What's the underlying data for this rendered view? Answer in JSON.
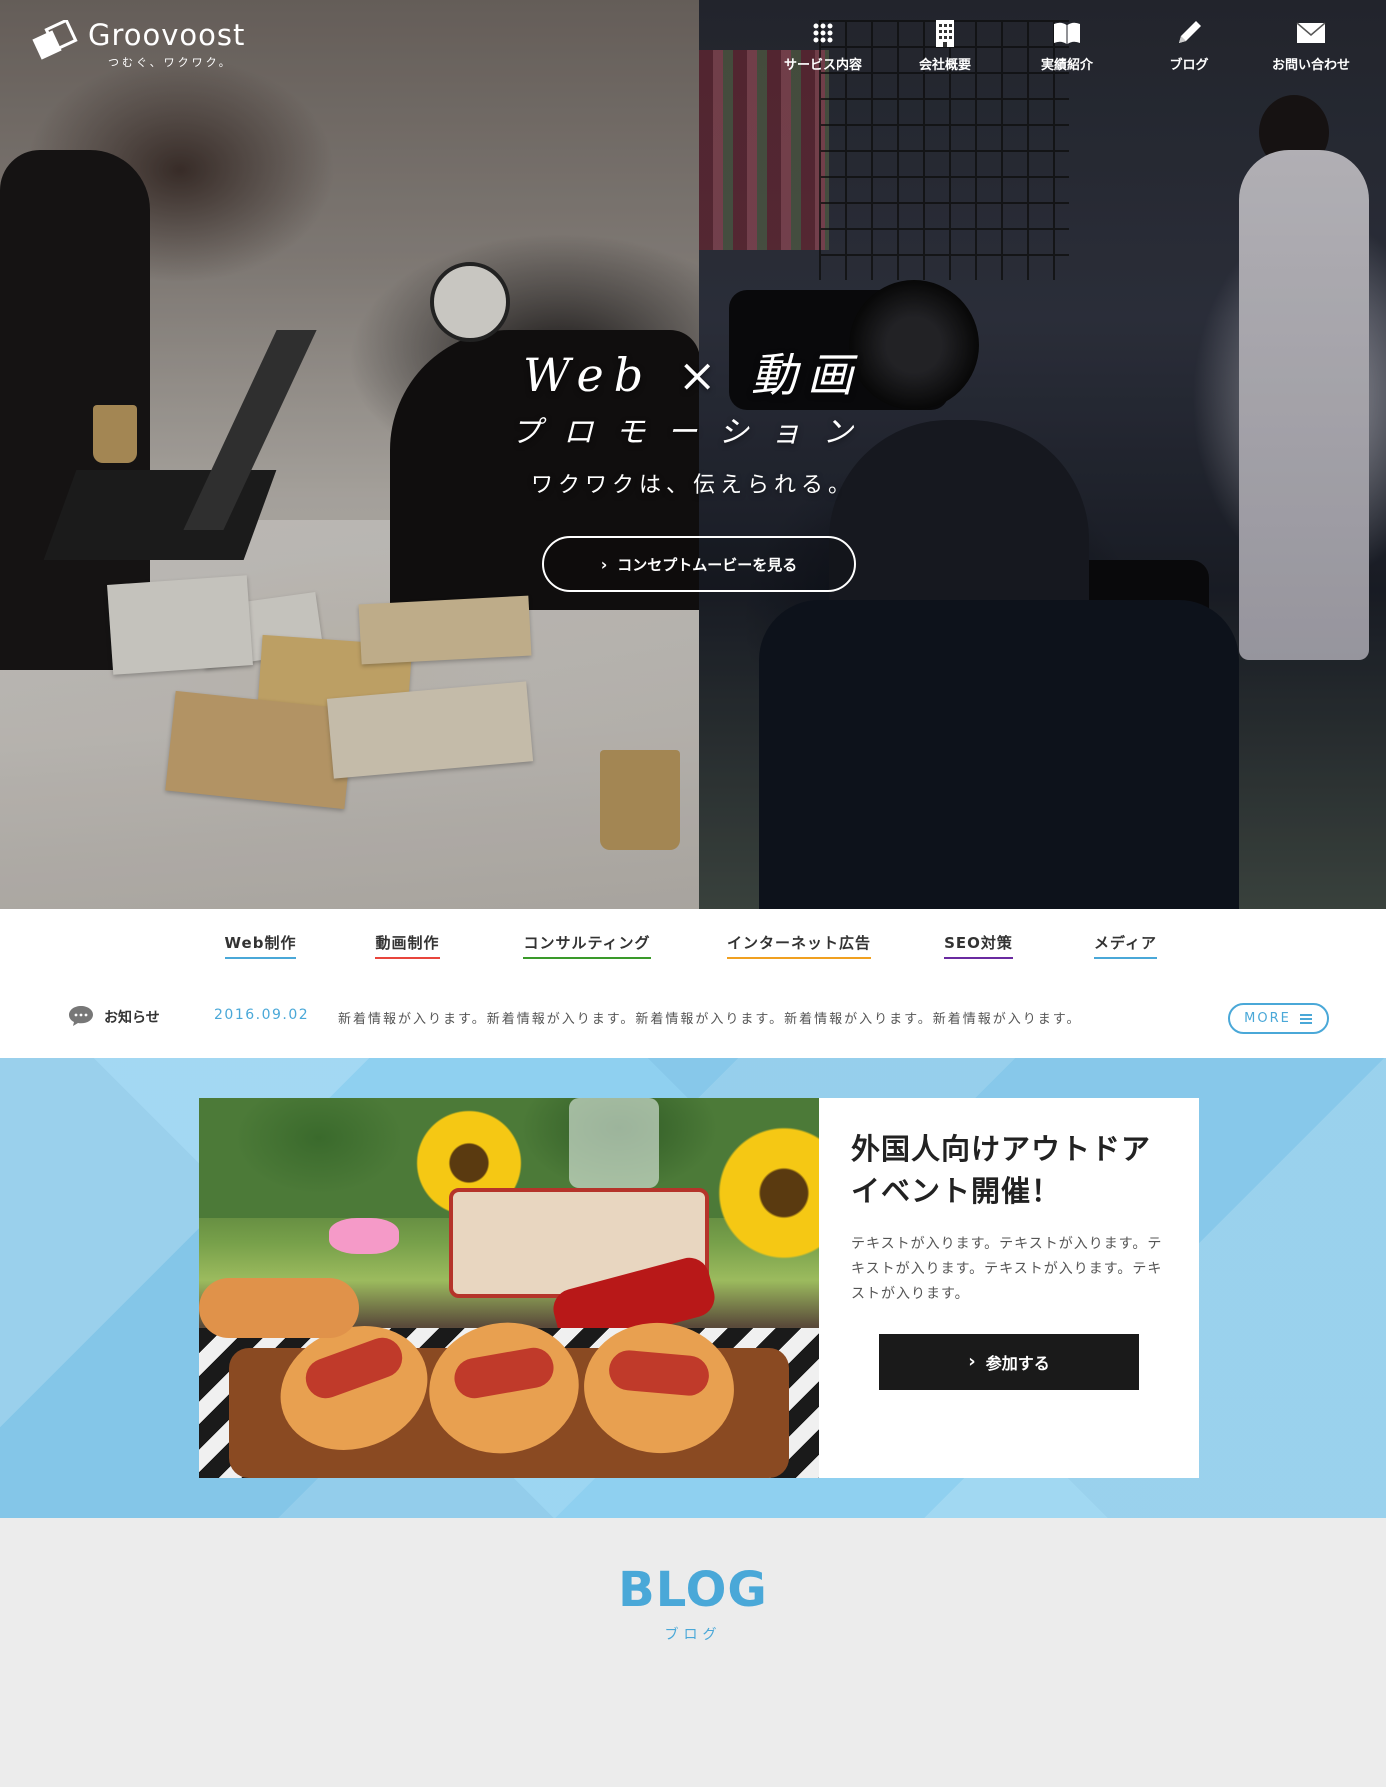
{
  "header": {
    "logo_name": "Groovoost",
    "logo_tagline": "つむぐ、ワクワク。",
    "nav": [
      {
        "label": "サービス内容",
        "icon": "grid-icon"
      },
      {
        "label": "会社概要",
        "icon": "building-icon"
      },
      {
        "label": "実績紹介",
        "icon": "book-icon"
      },
      {
        "label": "ブログ",
        "icon": "pencil-icon"
      },
      {
        "label": "お問い合わせ",
        "icon": "mail-icon"
      }
    ]
  },
  "hero": {
    "title": "Web × 動画",
    "title2": "プロモーション",
    "subtitle": "ワクワクは、伝えられる。",
    "button_label": "コンセプトムービーを見る"
  },
  "services": [
    {
      "label": "Web制作",
      "color": "#4aa8d8"
    },
    {
      "label": "動画制作",
      "color": "#e8453c"
    },
    {
      "label": "コンサルティング",
      "color": "#3a9a2a"
    },
    {
      "label": "インターネット広告",
      "color": "#f0a020"
    },
    {
      "label": "SEO対策",
      "color": "#6a2aa0"
    },
    {
      "label": "メディア",
      "color": "#4aa8d8"
    }
  ],
  "news": {
    "label": "お知らせ",
    "date": "2016.09.02",
    "text": "新着情報が入ります。新着情報が入ります。新着情報が入ります。新着情報が入ります。新着情報が入ります。",
    "more_label": "MORE"
  },
  "event": {
    "title": "外国人向けアウトドアイベント開催！",
    "desc": "テキストが入ります。テキストが入ります。テキストが入ります。テキストが入ります。テキストが入ります。",
    "button_label": "参加する"
  },
  "blog": {
    "title": "BLOG",
    "subtitle": "ブログ"
  },
  "colors": {
    "accent": "#4aa8d8",
    "event_bg": "#8fd0f0",
    "dark_button": "#1a1a1a"
  }
}
